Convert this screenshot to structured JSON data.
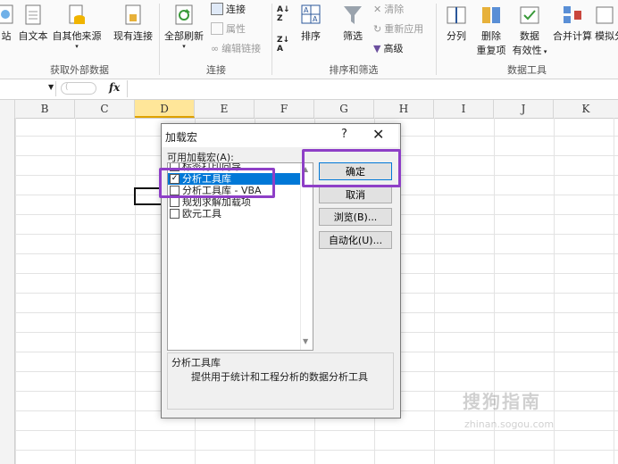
{
  "ribbon": {
    "items": {
      "web": "站",
      "text": "自文本",
      "other_sources": "自其他来源",
      "existing_conn": "现有连接",
      "refresh_all": "全部刷新",
      "sort": "排序",
      "filter": "筛选",
      "split": "分列",
      "remove_dup_1": "删除",
      "remove_dup_2": "重复项",
      "validation_1": "数据",
      "validation_2": "有效性",
      "consolidate": "合并计算",
      "simulate": "模拟分"
    },
    "small": {
      "connections": "连接",
      "properties": "属性",
      "edit_links": "编辑链接",
      "clear": "清除",
      "reapply": "重新应用",
      "advanced": "高级"
    },
    "groups": {
      "get_external": "获取外部数据",
      "connections": "连接",
      "sort_filter": "排序和筛选",
      "data_tools": "数据工具"
    }
  },
  "formula_bar": {
    "fx": "fx"
  },
  "columns": [
    "B",
    "C",
    "D",
    "E",
    "F",
    "G",
    "H",
    "I",
    "J",
    "K"
  ],
  "active_column": "D",
  "dialog": {
    "title": "加载宏",
    "help": "?",
    "close": "✕",
    "available_label": "可用加载宏(A):",
    "items": [
      {
        "label": "标签打印向导",
        "checked": false
      },
      {
        "label": "分析工具库",
        "checked": true
      },
      {
        "label": "分析工具库 - VBA",
        "checked": false
      },
      {
        "label": "规划求解加载项",
        "checked": false
      },
      {
        "label": "欧元工具",
        "checked": false
      }
    ],
    "selected_index": 1,
    "buttons": {
      "ok": "确定",
      "cancel": "取消",
      "browse": "浏览(B)...",
      "automation": "自动化(U)..."
    },
    "description_title": "分析工具库",
    "description_text": "提供用于统计和工程分析的数据分析工具"
  },
  "watermark": {
    "main": "搜狗指南",
    "sub": "zhinan.sogou.com"
  },
  "colors": {
    "highlight": "#8e3fc7",
    "selection": "#0078d7",
    "active_col": "#ffe699"
  }
}
